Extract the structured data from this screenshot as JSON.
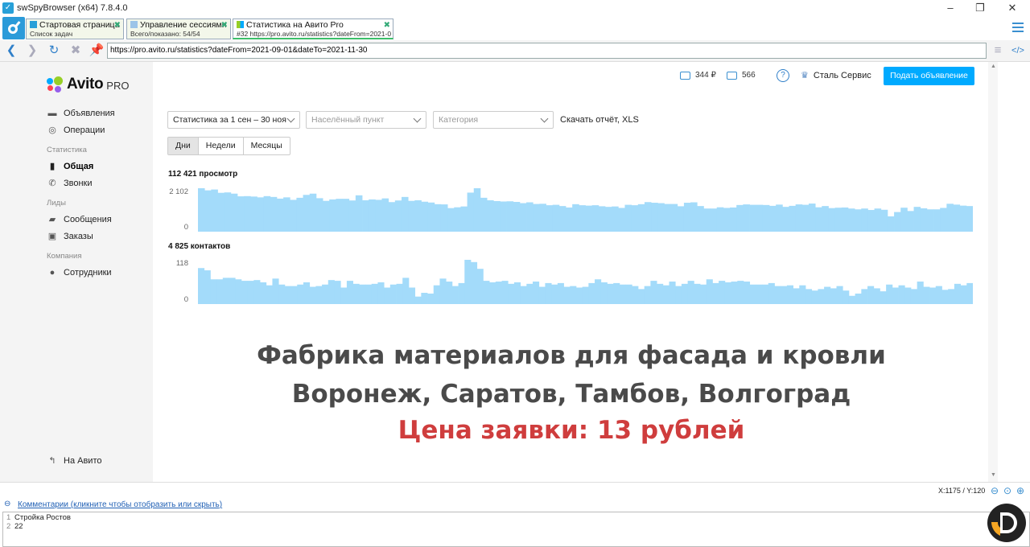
{
  "window": {
    "title": "swSpyBrowser (x64) 7.8.4.0",
    "controls": {
      "minimize": "–",
      "maximize": "❐",
      "close": "✕"
    }
  },
  "tabs": [
    {
      "title": "Стартовая страница",
      "subtitle": "Список задач"
    },
    {
      "title": "Управление сессиями",
      "subtitle": "Всего/показано: 54/54"
    },
    {
      "title": "Статистика на Авито Pro",
      "subtitle": "#32 https://pro.avito.ru/statistics?dateFrom=2021-0"
    }
  ],
  "navbar": {
    "url": "https://pro.avito.ru/statistics?dateFrom=2021-09-01&dateTo=2021-11-30"
  },
  "brand": {
    "name": "Avito",
    "suffix": "PRO"
  },
  "sidebar": {
    "items": [
      {
        "label": "Объявления",
        "icon": "listings-icon"
      },
      {
        "label": "Операции",
        "icon": "operations-icon"
      },
      {
        "section": "Статистика"
      },
      {
        "label": "Общая",
        "icon": "bar-chart-icon",
        "active": true
      },
      {
        "label": "Звонки",
        "icon": "phone-icon"
      },
      {
        "section": "Лиды"
      },
      {
        "label": "Сообщения",
        "icon": "message-icon"
      },
      {
        "label": "Заказы",
        "icon": "orders-icon"
      },
      {
        "section": "Компания"
      },
      {
        "label": "Сотрудники",
        "icon": "user-icon"
      }
    ],
    "footer_link": "На Авито"
  },
  "topbar": {
    "balance": "344 ₽",
    "bonus": "566",
    "help": "?",
    "company": "Сталь Сервис",
    "post_button": "Подать объявление"
  },
  "filters": {
    "period": "Статистика за 1 сен – 30 ноя",
    "city_placeholder": "Населённый пункт",
    "category_placeholder": "Категория",
    "download": "Скачать отчёт, XLS"
  },
  "granularity": {
    "options": [
      "Дни",
      "Недели",
      "Месяцы"
    ],
    "selected": "Дни"
  },
  "bar_color": "#a3dbfa",
  "chart_data": [
    {
      "type": "bar",
      "title": "112 421 просмотр",
      "ylim": [
        0,
        2102
      ],
      "yticks": [
        "2 102",
        "0"
      ],
      "values": [
        2102,
        2000,
        2040,
        1880,
        1900,
        1840,
        1710,
        1720,
        1700,
        1660,
        1720,
        1680,
        1600,
        1660,
        1540,
        1640,
        1780,
        1840,
        1620,
        1490,
        1560,
        1590,
        1590,
        1510,
        1760,
        1520,
        1560,
        1540,
        1610,
        1430,
        1510,
        1680,
        1490,
        1520,
        1450,
        1410,
        1330,
        1320,
        1140,
        1180,
        1220,
        1890,
        2310,
        1640,
        1520,
        1480,
        1460,
        1470,
        1440,
        1380,
        1420,
        1340,
        1350,
        1280,
        1300,
        1240,
        1170,
        1330,
        1280,
        1260,
        1280,
        1230,
        1200,
        1220,
        1150,
        1300,
        1280,
        1330,
        1430,
        1400,
        1380,
        1340,
        1340,
        1230,
        1400,
        1420,
        1240,
        1120,
        1120,
        1180,
        1150,
        1170,
        1290,
        1320,
        1300,
        1300,
        1290,
        1250,
        1310,
        1200,
        1250,
        1320,
        1300,
        1360,
        1180,
        1240,
        1140,
        1160,
        1170,
        1120,
        1080,
        1120,
        1050,
        1120,
        1060,
        740,
        950,
        1160,
        1000,
        1200,
        1130,
        1080,
        1080,
        1150,
        1350,
        1310,
        1260,
        1240
      ],
      "bar_color": "#a3dbfa"
    },
    {
      "type": "bar",
      "title": "4 825 контактов",
      "ylim": [
        0,
        118
      ],
      "yticks": [
        "118",
        "0"
      ],
      "values": [
        96,
        90,
        66,
        66,
        70,
        70,
        66,
        62,
        62,
        64,
        58,
        50,
        68,
        52,
        48,
        48,
        52,
        58,
        46,
        48,
        52,
        64,
        62,
        44,
        62,
        54,
        52,
        52,
        54,
        58,
        44,
        52,
        54,
        70,
        44,
        20,
        30,
        28,
        50,
        68,
        60,
        48,
        56,
        118,
        112,
        94,
        62,
        58,
        60,
        62,
        54,
        58,
        48,
        54,
        60,
        46,
        56,
        52,
        56,
        46,
        48,
        44,
        46,
        56,
        66,
        58,
        54,
        56,
        52,
        52,
        48,
        40,
        48,
        62,
        54,
        50,
        60,
        48,
        54,
        62,
        54,
        52,
        66,
        56,
        62,
        58,
        60,
        62,
        60,
        52,
        52,
        52,
        56,
        48,
        48,
        50,
        42,
        50,
        40,
        36,
        40,
        46,
        42,
        48,
        36,
        22,
        28,
        40,
        48,
        42,
        34,
        52,
        44,
        50,
        44,
        40,
        60,
        46,
        44,
        48,
        38,
        40,
        54,
        50,
        56
      ]
    }
  ],
  "promo": {
    "line1": "Фабрика материалов для фасада и кровли",
    "line2": "Воронеж, Саратов, Тамбов, Волгоград",
    "line3": "Цена заявки: 13 рублей",
    "highlight_color": "#cf3d3d"
  },
  "status": {
    "coords": "X:1175 / Y:120"
  },
  "comments": {
    "link": "Комментарии (кликните чтобы отобразить или скрыть)",
    "lines": [
      {
        "n": "1",
        "text": "Стройка Ростов"
      },
      {
        "n": "2",
        "text": "22"
      }
    ]
  }
}
